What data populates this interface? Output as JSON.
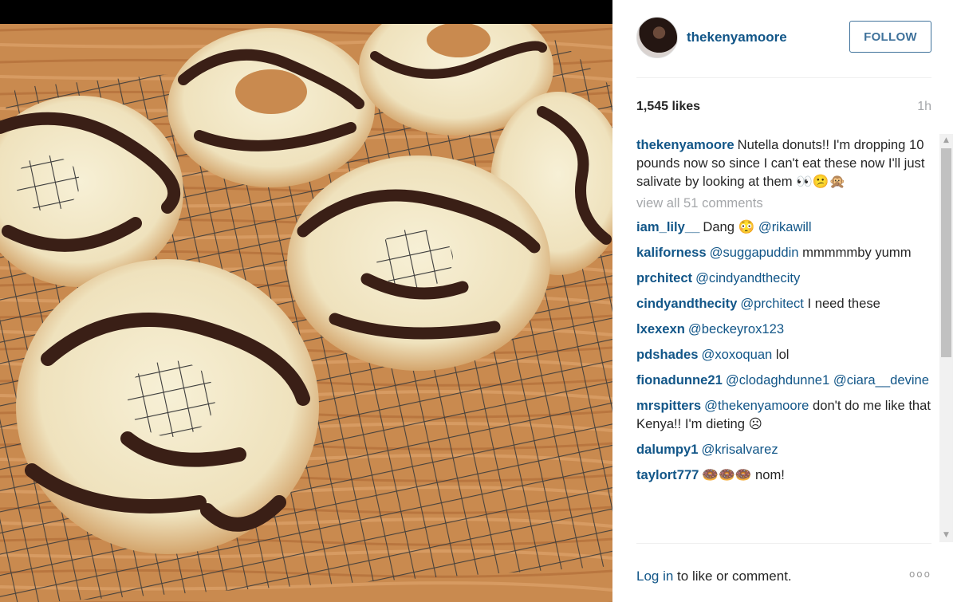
{
  "post": {
    "author": "thekenyamoore",
    "follow_label": "FOLLOW",
    "likes": "1,545 likes",
    "time_ago": "1h",
    "caption": {
      "user": "thekenyamoore",
      "text": "Nutella donuts!! I'm dropping 10 pounds now so since I can't eat these now I'll just salivate by looking at them 👀😕🙊"
    },
    "view_all_comments": "view all 51 comments"
  },
  "comments": [
    {
      "user": "iam_lily__",
      "parts": [
        {
          "t": "text",
          "v": "Dang 😳 "
        },
        {
          "t": "mention",
          "v": "@rikawill"
        }
      ]
    },
    {
      "user": "kaliforness",
      "parts": [
        {
          "t": "mention",
          "v": "@suggapuddin"
        },
        {
          "t": "text",
          "v": " mmmmmby yumm"
        }
      ]
    },
    {
      "user": "prchitect",
      "parts": [
        {
          "t": "mention",
          "v": "@cindyandthecity"
        }
      ]
    },
    {
      "user": "cindyandthecity",
      "parts": [
        {
          "t": "mention",
          "v": "@prchitect"
        },
        {
          "t": "text",
          "v": " I need these"
        }
      ]
    },
    {
      "user": "lxexexn",
      "parts": [
        {
          "t": "mention",
          "v": "@beckeyrox123"
        }
      ]
    },
    {
      "user": "pdshades",
      "parts": [
        {
          "t": "mention",
          "v": "@xoxoquan"
        },
        {
          "t": "text",
          "v": " lol"
        }
      ]
    },
    {
      "user": "fionadunne21",
      "parts": [
        {
          "t": "mention",
          "v": "@clodaghdunne1"
        },
        {
          "t": "text",
          "v": " "
        },
        {
          "t": "mention",
          "v": "@ciara__devine"
        }
      ]
    },
    {
      "user": "mrspitters",
      "parts": [
        {
          "t": "mention",
          "v": "@thekenyamoore"
        },
        {
          "t": "text",
          "v": " don't do me like that Kenya!! I'm dieting ☹"
        }
      ]
    },
    {
      "user": "dalumpy1",
      "parts": [
        {
          "t": "mention",
          "v": "@krisalvarez"
        }
      ]
    },
    {
      "user": "taylort777",
      "parts": [
        {
          "t": "text",
          "v": "🍩🍩🍩 nom!"
        }
      ]
    }
  ],
  "footer": {
    "login_link": "Log in",
    "login_suffix": " to like or comment.",
    "more_options": "ooo"
  },
  "icons": {
    "avatar": "profile-photo",
    "scroll_up": "▲",
    "scroll_down": "▼"
  },
  "colors": {
    "link": "#125688",
    "follow": "#3f729b",
    "muted": "#a5a7aa",
    "text": "#262626"
  }
}
